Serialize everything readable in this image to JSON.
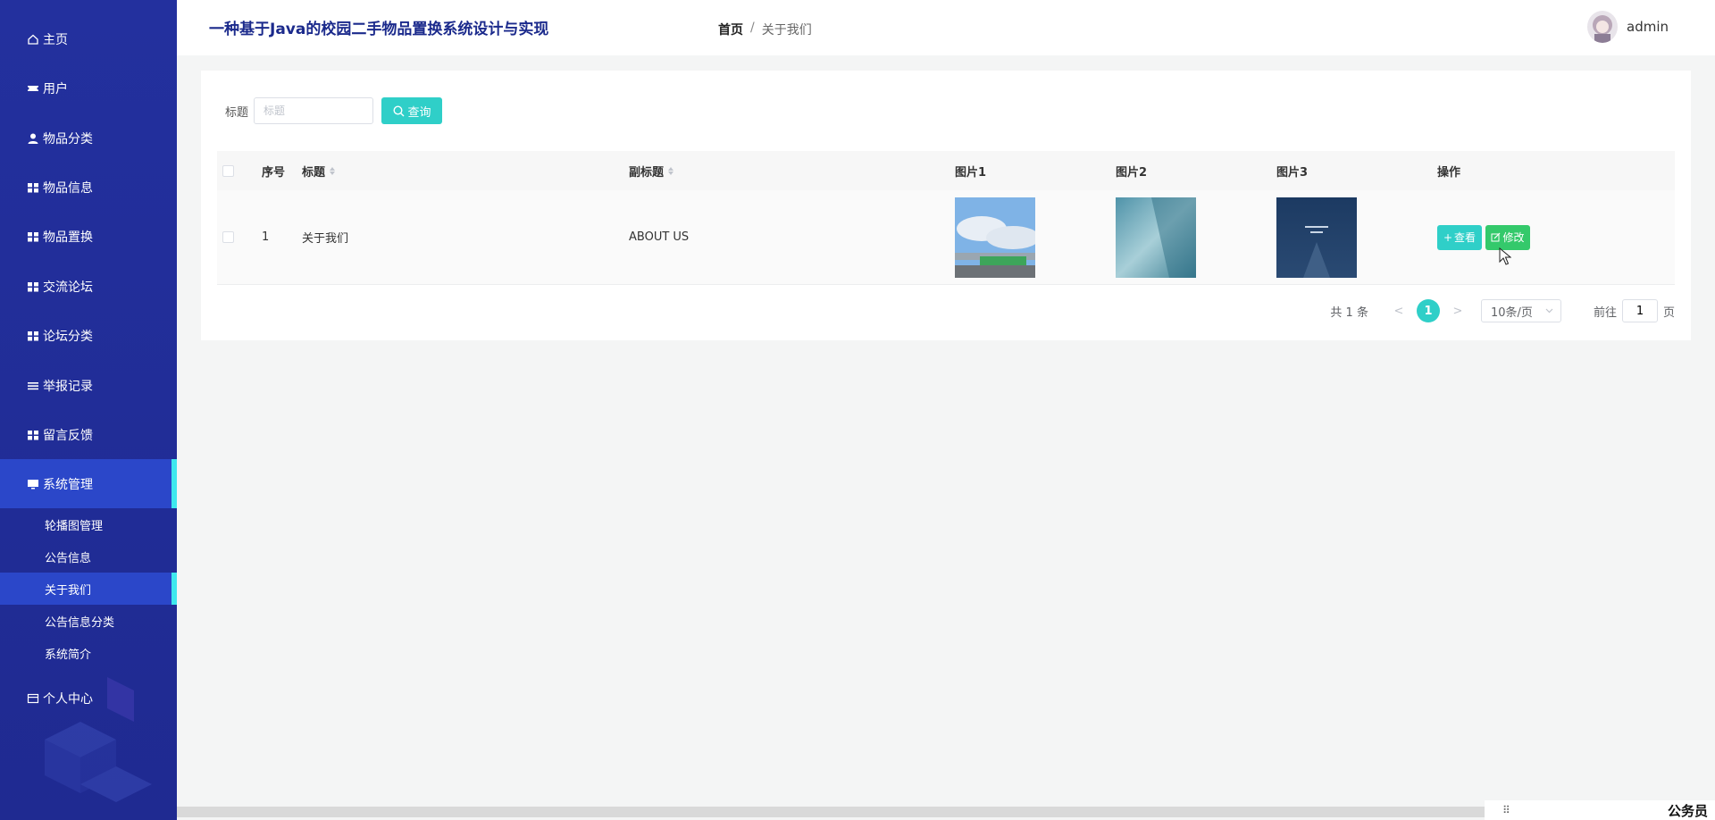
{
  "app": {
    "title": "一种基于Java的校园二手物品置换系统设计与实现"
  },
  "breadcrumb": {
    "home": "首页",
    "separator": "/",
    "current": "关于我们"
  },
  "user": {
    "name": "admin"
  },
  "sidebar": {
    "items": [
      {
        "label": "主页",
        "icon": "home-icon"
      },
      {
        "label": "用户",
        "icon": "ticket-icon"
      },
      {
        "label": "物品分类",
        "icon": "user-icon"
      },
      {
        "label": "物品信息",
        "icon": "grid-icon"
      },
      {
        "label": "物品置换",
        "icon": "grid-icon"
      },
      {
        "label": "交流论坛",
        "icon": "grid-icon"
      },
      {
        "label": "论坛分类",
        "icon": "grid-icon"
      },
      {
        "label": "举报记录",
        "icon": "list-icon"
      },
      {
        "label": "留言反馈",
        "icon": "grid-icon"
      },
      {
        "label": "系统管理",
        "icon": "monitor-icon"
      },
      {
        "label": "个人中心",
        "icon": "card-icon"
      }
    ],
    "sub_items": [
      "轮播图管理",
      "公告信息",
      "关于我们",
      "公告信息分类",
      "系统简介"
    ]
  },
  "search": {
    "label": "标题",
    "placeholder": "标题",
    "button": "查询"
  },
  "table": {
    "headers": {
      "index": "序号",
      "title": "标题",
      "subtitle": "副标题",
      "img1": "图片1",
      "img2": "图片2",
      "img3": "图片3",
      "actions": "操作"
    },
    "rows": [
      {
        "index": "1",
        "title": "关于我们",
        "subtitle": "ABOUT US",
        "view": "查看",
        "edit": "修改"
      }
    ]
  },
  "pagination": {
    "total": "共 1 条",
    "prev": "<",
    "next": ">",
    "current": "1",
    "page_size": "10条/页",
    "goto_label": "前往",
    "goto_value": "1",
    "page_unit": "页"
  },
  "corner": {
    "text": "公务员"
  },
  "colors": {
    "sidebar": "#23309e",
    "accent": "#2fcfc8",
    "active": "#2b47c9",
    "edit": "#34c96b"
  }
}
